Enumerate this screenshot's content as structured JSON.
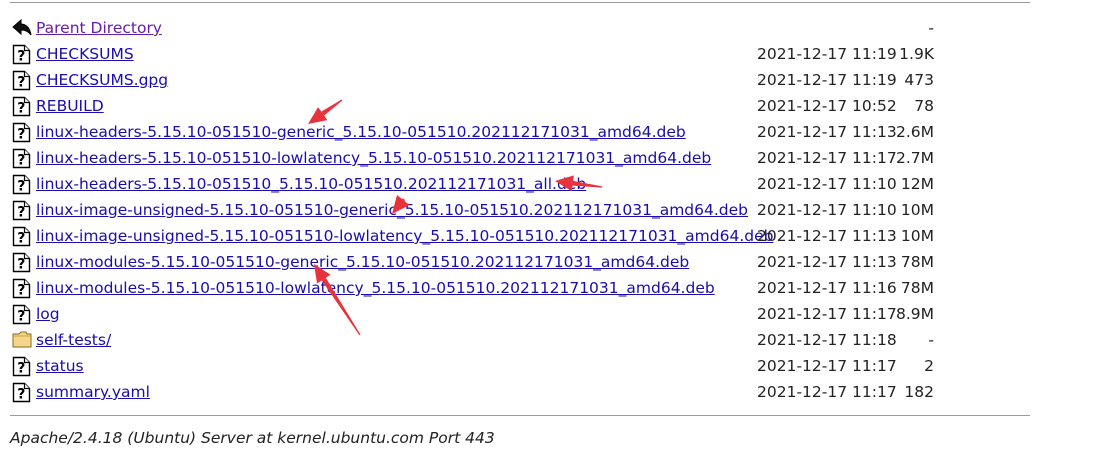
{
  "listing": {
    "rows": [
      {
        "icon": "back-arrow-icon",
        "name": "Parent Directory",
        "date": "",
        "size": "-",
        "visited": true
      },
      {
        "icon": "unknown-file-icon",
        "name": "CHECKSUMS",
        "date": "2021-12-17 11:19",
        "size": "1.9K"
      },
      {
        "icon": "unknown-file-icon",
        "name": "CHECKSUMS.gpg",
        "date": "2021-12-17 11:19",
        "size": "473"
      },
      {
        "icon": "unknown-file-icon",
        "name": "REBUILD",
        "date": "2021-12-17 10:52",
        "size": "78"
      },
      {
        "icon": "unknown-file-icon",
        "name": "linux-headers-5.15.10-051510-generic_5.15.10-051510.202112171031_amd64.deb",
        "date": "2021-12-17 11:13",
        "size": "2.6M"
      },
      {
        "icon": "unknown-file-icon",
        "name": "linux-headers-5.15.10-051510-lowlatency_5.15.10-051510.202112171031_amd64.deb",
        "date": "2021-12-17 11:17",
        "size": "2.7M"
      },
      {
        "icon": "unknown-file-icon",
        "name": "linux-headers-5.15.10-051510_5.15.10-051510.202112171031_all.deb",
        "date": "2021-12-17 11:10",
        "size": "12M"
      },
      {
        "icon": "unknown-file-icon",
        "name": "linux-image-unsigned-5.15.10-051510-generic_5.15.10-051510.202112171031_amd64.deb",
        "date": "2021-12-17 11:10",
        "size": "10M"
      },
      {
        "icon": "unknown-file-icon",
        "name": "linux-image-unsigned-5.15.10-051510-lowlatency_5.15.10-051510.202112171031_amd64.deb",
        "date": "2021-12-17 11:13",
        "size": "10M"
      },
      {
        "icon": "unknown-file-icon",
        "name": "linux-modules-5.15.10-051510-generic_5.15.10-051510.202112171031_amd64.deb",
        "date": "2021-12-17 11:13",
        "size": "78M"
      },
      {
        "icon": "unknown-file-icon",
        "name": "linux-modules-5.15.10-051510-lowlatency_5.15.10-051510.202112171031_amd64.deb",
        "date": "2021-12-17 11:16",
        "size": "78M"
      },
      {
        "icon": "unknown-file-icon",
        "name": "log",
        "date": "2021-12-17 11:17",
        "size": "8.9M"
      },
      {
        "icon": "folder-icon",
        "name": "self-tests/",
        "date": "2021-12-17 11:18",
        "size": "-"
      },
      {
        "icon": "unknown-file-icon",
        "name": "status",
        "date": "2021-12-17 11:17",
        "size": "2"
      },
      {
        "icon": "unknown-file-icon",
        "name": "summary.yaml",
        "date": "2021-12-17 11:17",
        "size": "182"
      }
    ]
  },
  "footer": {
    "server_signature": "Apache/2.4.18 (Ubuntu) Server at kernel.ubuntu.com Port 443"
  },
  "annotations": {
    "arrow_color": "#e8323c",
    "arrows": [
      {
        "name": "arrow-to-headers-generic"
      },
      {
        "name": "arrow-to-headers-all"
      },
      {
        "name": "arrow-to-image-generic"
      },
      {
        "name": "arrow-to-modules-generic"
      }
    ]
  },
  "colors": {
    "link": "#1a0dab",
    "visited_link": "#681da8",
    "rule": "#9a9a9a"
  }
}
